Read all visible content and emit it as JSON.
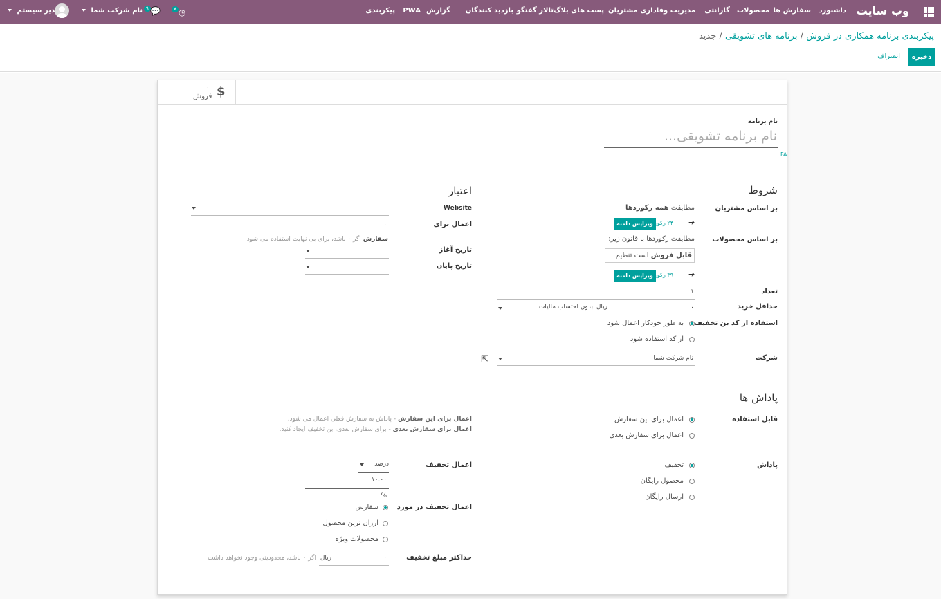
{
  "navbar": {
    "brand": "وب سایت",
    "menu": [
      "داشبورد",
      "سفارش ها",
      "محصولات",
      "گارانتی",
      "مدیریت وفاداری مشتریان",
      "پست های بلاگ",
      "تالار گفتگو",
      "بازدید کنندگان",
      "گزارش",
      "PWA",
      "پیکربندی"
    ],
    "activity_count": "۷",
    "messages_count": "۹",
    "company": "نام شرکت شما",
    "user": "مدیر سیستم"
  },
  "breadcrumb": {
    "part1": "پیکربندی برنامه همکاری در فروش",
    "part2": "برنامه های تشویقی",
    "part3": "جدید",
    "sep": "/"
  },
  "actions": {
    "save": "ذخیره",
    "discard": "انصراف"
  },
  "button_box": {
    "sales_icon": "$",
    "sales_count": "۰",
    "sales_label": "فروش"
  },
  "name": {
    "label": "نام برنامه",
    "placeholder": "نام برنامه تشویقی...",
    "lang": "FA"
  },
  "conditions": {
    "title": "شروط",
    "customers_label": "بر اساس مشتریان",
    "customers_text_a": "مطابقت ",
    "customers_text_b": "همه رکوردها",
    "customers_count": "۲۴ رکورد",
    "edit_domain": "ویرایش دامنه",
    "products_label": "بر اساس محصولات",
    "products_text": "مطابقت رکوردها با قانون زیر:",
    "rule_a": "قابل فروش",
    "rule_b": "است",
    "rule_c": "تنظیم",
    "products_count": "۳۹ رکورد",
    "quantity_label": "تعداد",
    "quantity_value": "۱",
    "min_purchase_label": "حداقل خرید",
    "min_purchase_value": "۰",
    "currency": "ریال",
    "tax_option": "بدون احتساب مالیات",
    "code_label": "استفاده از کد بن تخفیف",
    "code_opt1": "به طور خودکار اعمال شود",
    "code_opt2": "از کد استفاده شود",
    "company_label": "شرکت",
    "company_value": "نام شرکت شما"
  },
  "validity": {
    "title": "اعتبار",
    "website_label": "Website",
    "apply_label": "اعمال برای",
    "apply_value": "۰",
    "apply_unit": "سفارش",
    "apply_help": "اگر ۰ باشد، برای بی نهایت استفاده می شود",
    "start_label": "تاریخ آغاز",
    "end_label": "تاریخ پایان"
  },
  "rewards": {
    "title": "پاداش ها",
    "applicable_label": "قابل استفاده",
    "opt_current": "اعمال برای این سفارش",
    "opt_next": "اعمال برای سفارش بعدی",
    "help1_b": "اعمال برای این سفارش",
    "help1": " - پاداش به سفارش فعلی اعمال می شود.",
    "help2_b": "اعمال برای سفارش بعدی",
    "help2": " - برای سفارش بعدی، بن تخفیف ایجاد کنید.",
    "reward_label": "پاداش",
    "reward_opt1": "تخفیف",
    "reward_opt2": "محصول رایگان",
    "reward_opt3": "ارسال رایگان",
    "apply_discount_label": "اعمال تخفیف",
    "discount_type": "درصد",
    "discount_value": "۱۰.۰۰",
    "percent_sign": "%",
    "apply_on_label": "اعمال تخفیف در مورد",
    "apply_on_opt1": "سفارش",
    "apply_on_opt2": "ارزان ترین محصول",
    "apply_on_opt3": "محصولات ویژه",
    "max_label": "حداکثر مبلغ تخفیف",
    "max_value": "۰",
    "max_currency": "ریال",
    "max_help": "اگر ۰ باشد، محدودیتی وجود نخواهد داشت"
  },
  "colors": {
    "navbar": "#875a7b",
    "accent": "#00a09d"
  }
}
